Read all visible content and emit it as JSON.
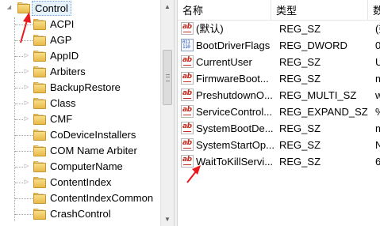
{
  "tree": {
    "root": {
      "label": "Control",
      "icon": "folder-open-icon",
      "selected": true
    },
    "items": [
      {
        "label": "ACPI",
        "expandable": false
      },
      {
        "label": "AGP",
        "expandable": false
      },
      {
        "label": "AppID",
        "expandable": true
      },
      {
        "label": "Arbiters",
        "expandable": true
      },
      {
        "label": "BackupRestore",
        "expandable": true
      },
      {
        "label": "Class",
        "expandable": true
      },
      {
        "label": "CMF",
        "expandable": true
      },
      {
        "label": "CoDeviceInstallers",
        "expandable": false
      },
      {
        "label": "COM Name Arbiter",
        "expandable": false
      },
      {
        "label": "ComputerName",
        "expandable": true
      },
      {
        "label": "ContentIndex",
        "expandable": true
      },
      {
        "label": "ContentIndexCommon",
        "expandable": false
      },
      {
        "label": "CrashControl",
        "expandable": false
      }
    ]
  },
  "list": {
    "columns": {
      "name": "名称",
      "type": "类型",
      "data": "数"
    },
    "rows": [
      {
        "icon": "string-value-icon",
        "name": "(默认)",
        "type": "REG_SZ",
        "data": "(数"
      },
      {
        "icon": "binary-value-icon",
        "name": "BootDriverFlags",
        "type": "REG_DWORD",
        "data": "0x"
      },
      {
        "icon": "string-value-icon",
        "name": "CurrentUser",
        "type": "REG_SZ",
        "data": "U"
      },
      {
        "icon": "string-value-icon",
        "name": "FirmwareBoot...",
        "type": "REG_SZ",
        "data": "m"
      },
      {
        "icon": "string-value-icon",
        "name": "PreshutdownO...",
        "type": "REG_MULTI_SZ",
        "data": "w"
      },
      {
        "icon": "string-value-icon",
        "name": "ServiceControl...",
        "type": "REG_EXPAND_SZ",
        "data": "%"
      },
      {
        "icon": "string-value-icon",
        "name": "SystemBootDe...",
        "type": "REG_SZ",
        "data": "m"
      },
      {
        "icon": "string-value-icon",
        "name": "SystemStartOp...",
        "type": "REG_SZ",
        "data": "N"
      },
      {
        "icon": "string-value-icon",
        "name": "WaitToKillServi...",
        "type": "REG_SZ",
        "data": "6"
      }
    ]
  },
  "annotation_color": "#e8191c"
}
